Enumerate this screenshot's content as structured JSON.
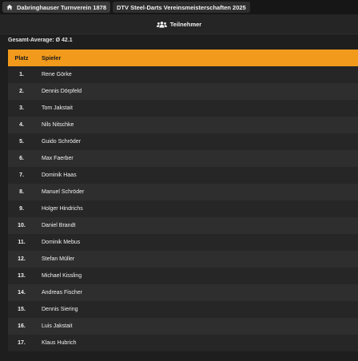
{
  "breadcrumb": {
    "club": "Dabringhauser Turnverein 1878",
    "event": "DTV Steel-Darts Vereinsmeisterschaften 2025"
  },
  "tab": {
    "label": "Teilnehmer",
    "icon": "users-icon"
  },
  "average_label": "Gesamt-Average: Ø 42.1",
  "table": {
    "headers": {
      "rank": "Platz",
      "player": "Spieler"
    },
    "rows": [
      {
        "rank": "1.",
        "name": "Rene Görke"
      },
      {
        "rank": "2.",
        "name": "Dennis Dörpfeld"
      },
      {
        "rank": "3.",
        "name": "Tom Jakstait"
      },
      {
        "rank": "4.",
        "name": "Nils Nitschke"
      },
      {
        "rank": "5.",
        "name": "Guido Schröder"
      },
      {
        "rank": "6.",
        "name": "Max Faerber"
      },
      {
        "rank": "7.",
        "name": "Dominik Haas"
      },
      {
        "rank": "8.",
        "name": "Manuel Schröder"
      },
      {
        "rank": "9.",
        "name": "Holger Hindrichs"
      },
      {
        "rank": "10.",
        "name": "Daniel Brandt"
      },
      {
        "rank": "11.",
        "name": "Dominik Mebus"
      },
      {
        "rank": "12.",
        "name": "Stefan Müller"
      },
      {
        "rank": "13.",
        "name": "Michael Kissling"
      },
      {
        "rank": "14.",
        "name": "Andreas Fischer"
      },
      {
        "rank": "15.",
        "name": "Dennis Siering"
      },
      {
        "rank": "16.",
        "name": "Luis Jakstait"
      },
      {
        "rank": "17.",
        "name": "Klaus Hubrich"
      }
    ]
  },
  "colors": {
    "header": "#f29a1c",
    "background": "#1e1e1e"
  }
}
